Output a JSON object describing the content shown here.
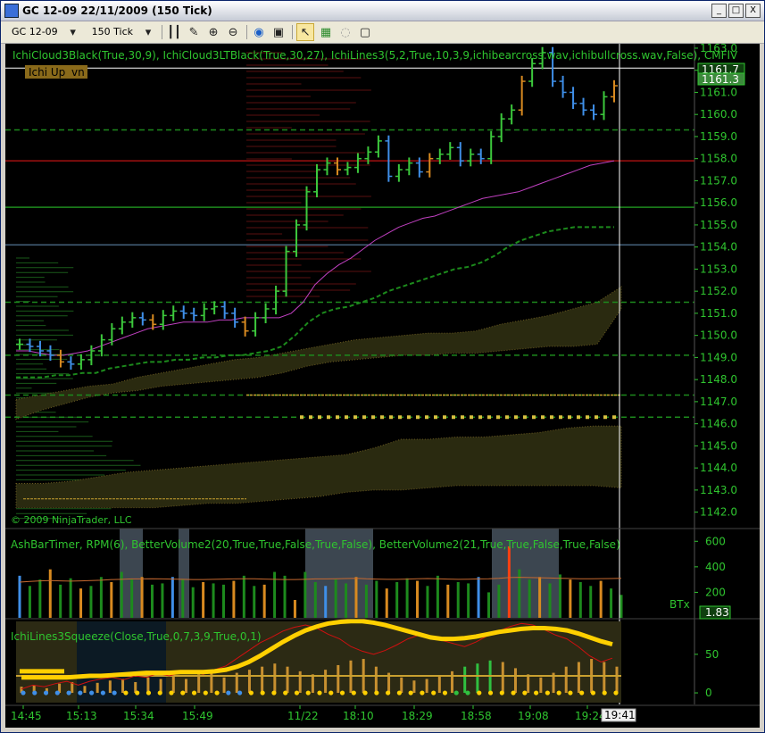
{
  "window": {
    "title": "GC 12-09  22/11/2009 (150 Tick)",
    "buttons": [
      "_",
      "□",
      "X"
    ]
  },
  "toolbar": {
    "instrument": "GC 12-09",
    "interval": "150 Tick",
    "icons": [
      "bar-type-icon",
      "pencil-icon",
      "zoom-in-icon",
      "zoom-out-icon",
      "globe-icon",
      "properties-icon",
      "cursor-icon",
      "data-box-icon",
      "ninja-icon",
      "copy-icon"
    ]
  },
  "chart_data": [
    {
      "type": "line",
      "panel": "price",
      "indicator_label": "IchiCloud3Black(True,30,9),  IchiCloud3LTBlack(True,30,27),  IchiLines3(5,2,True,10,3,9,ichibearcross.wav,ichibullcross.wav,False),  CMFIV",
      "status_label": "Ichi Up",
      "status_label_suffix": "vn",
      "copyright": "© 2009 NinjaTrader, LLC",
      "ylim": [
        1141.5,
        1163.2
      ],
      "yticks": [
        "1163.0",
        "1162.0",
        "1161.0",
        "1160.0",
        "1159.0",
        "1158.0",
        "1157.0",
        "1156.0",
        "1155.0",
        "1154.0",
        "1153.0",
        "1152.0",
        "1151.0",
        "1150.0",
        "1149.0",
        "1148.0",
        "1147.0",
        "1146.0",
        "1145.0",
        "1144.0",
        "1143.0",
        "1142.0"
      ],
      "last_price_labels": [
        "1161.7",
        "1161.3"
      ],
      "close": [
        1149.6,
        1149.5,
        1149.3,
        1149.1,
        1148.8,
        1148.7,
        1148.9,
        1149.3,
        1149.8,
        1150.3,
        1150.6,
        1150.8,
        1150.7,
        1150.5,
        1150.9,
        1151.1,
        1151.0,
        1150.9,
        1151.2,
        1151.3,
        1151.0,
        1150.6,
        1150.2,
        1150.8,
        1151.2,
        1152.0,
        1153.8,
        1155.0,
        1156.5,
        1157.5,
        1157.8,
        1157.5,
        1157.6,
        1158.0,
        1158.3,
        1158.8,
        1157.2,
        1157.5,
        1157.8,
        1157.4,
        1158.0,
        1158.2,
        1158.5,
        1157.9,
        1158.2,
        1158.0,
        1159.0,
        1159.8,
        1160.2,
        1161.5,
        1162.3,
        1162.8,
        1161.5,
        1161.0,
        1160.5,
        1160.2,
        1160.0,
        1160.8,
        1161.3
      ],
      "high_low_range": [
        1.0,
        1.4
      ],
      "tenkan": [
        1149.3,
        1149.3,
        1149.2,
        1149.1,
        1149.1,
        1149.2,
        1149.3,
        1149.5,
        1149.7,
        1149.9,
        1150.1,
        1150.3,
        1150.4,
        1150.5,
        1150.6,
        1150.6,
        1150.6,
        1150.7,
        1150.7,
        1150.8,
        1150.8,
        1150.8,
        1150.8,
        1151.0,
        1151.5,
        1152.3,
        1152.8,
        1153.2,
        1153.5,
        1153.9,
        1154.3,
        1154.6,
        1154.9,
        1155.1,
        1155.3,
        1155.4,
        1155.6,
        1155.8,
        1156.0,
        1156.2,
        1156.3,
        1156.4,
        1156.5,
        1156.7,
        1156.9,
        1157.1,
        1157.3,
        1157.5,
        1157.7,
        1157.8,
        1157.9
      ],
      "kijun": [
        1148.1,
        1148.1,
        1148.1,
        1148.2,
        1148.2,
        1148.3,
        1148.3,
        1148.5,
        1148.6,
        1148.7,
        1148.8,
        1148.8,
        1148.9,
        1148.9,
        1149.0,
        1149.0,
        1149.1,
        1149.1,
        1149.2,
        1149.3,
        1149.5,
        1150.0,
        1150.6,
        1151.0,
        1151.2,
        1151.3,
        1151.5,
        1151.7,
        1152.0,
        1152.2,
        1152.4,
        1152.6,
        1152.8,
        1153.0,
        1153.1,
        1153.3,
        1153.6,
        1154.0,
        1154.3,
        1154.5,
        1154.7,
        1154.8,
        1154.9,
        1154.9,
        1154.9,
        1154.9
      ],
      "cloud_top": [
        1147.1,
        1147.3,
        1147.5,
        1147.7,
        1147.8,
        1148.1,
        1148.3,
        1148.5,
        1148.7,
        1148.9,
        1149.0,
        1149.2,
        1149.4,
        1149.6,
        1149.8,
        1149.9,
        1150.0,
        1150.1,
        1150.1,
        1150.2,
        1150.5,
        1150.7,
        1150.9,
        1151.2,
        1151.5,
        1152.2
      ],
      "cloud_bottom": [
        1146.2,
        1146.6,
        1146.9,
        1147.2,
        1147.4,
        1147.5,
        1147.7,
        1147.8,
        1147.9,
        1148.0,
        1148.1,
        1148.3,
        1148.6,
        1148.8,
        1148.9,
        1149.0,
        1149.1,
        1149.1,
        1149.2,
        1149.2,
        1149.3,
        1149.4,
        1149.5,
        1149.5,
        1149.6,
        1151.2
      ],
      "lt_cloud_top": [
        1143.3,
        1143.3,
        1143.4,
        1143.6,
        1143.8,
        1143.9,
        1144.0,
        1144.1,
        1144.2,
        1144.3,
        1144.4,
        1144.5,
        1144.6,
        1144.9,
        1145.3,
        1145.3,
        1145.4,
        1145.4,
        1145.5,
        1145.6,
        1145.8,
        1145.9,
        1145.9
      ],
      "lt_cloud_bottom": [
        1142.2,
        1142.2,
        1142.2,
        1142.2,
        1142.2,
        1142.2,
        1142.3,
        1142.4,
        1142.4,
        1142.5,
        1142.6,
        1142.7,
        1142.9,
        1143.0,
        1143.0,
        1143.1,
        1143.2,
        1143.2,
        1143.2,
        1143.2,
        1143.2,
        1143.2,
        1143.1
      ],
      "hlines": [
        1162.1,
        1159.3,
        1157.9,
        1155.8,
        1154.1,
        1151.5,
        1149.1,
        1147.3,
        1146.3
      ]
    },
    {
      "type": "bar",
      "panel": "volume",
      "indicator_label": "AshBarTimer,  RPM(6),  BetterVolume2(20,True,True,False,True,False),  BetterVolume2(21,True,True,False,True,False)",
      "ylim": [
        0,
        700
      ],
      "yticks": [
        "600",
        "400",
        "200"
      ],
      "right_label": "BTx",
      "value_label": "1.83",
      "values": [
        330,
        250,
        300,
        380,
        260,
        310,
        230,
        250,
        320,
        280,
        360,
        300,
        320,
        260,
        270,
        320,
        300,
        240,
        280,
        270,
        260,
        290,
        330,
        250,
        260,
        360,
        330,
        140,
        360,
        280,
        250,
        300,
        270,
        320,
        260,
        290,
        230,
        280,
        310,
        290,
        250,
        330,
        260,
        280,
        270,
        320,
        200,
        260,
        560,
        380,
        300,
        320,
        270,
        340,
        300,
        280,
        250,
        290,
        230,
        180
      ],
      "ma": [
        280,
        285,
        290,
        292,
        290,
        288,
        290,
        292,
        295,
        300,
        302,
        305,
        305,
        306,
        305,
        304,
        302,
        300,
        300,
        302,
        304,
        305,
        306,
        306,
        304,
        302,
        300,
        300,
        302,
        305,
        305,
        306,
        308,
        310,
        306,
        304,
        302,
        302,
        304,
        306,
        308,
        306,
        304,
        302,
        303,
        305,
        306,
        310,
        316,
        318,
        316,
        314,
        312,
        310,
        308,
        306,
        306,
        307,
        308,
        310
      ]
    },
    {
      "type": "area",
      "panel": "squeeze",
      "indicator_label": "IchiLines3Squeeze(Close,True,0,7,3,9,True,0,1)",
      "ylim": [
        -15,
        95
      ],
      "yticks": [
        "50",
        "0"
      ],
      "momentum_line": [
        20,
        20,
        20,
        20,
        20,
        21,
        22,
        22,
        23,
        24,
        25,
        26,
        26,
        26,
        27,
        27,
        27,
        28,
        30,
        34,
        40,
        48,
        57,
        66,
        74,
        81,
        86,
        90,
        92,
        93,
        93,
        91,
        88,
        84,
        80,
        76,
        72,
        70,
        70,
        71,
        73,
        76,
        79,
        81,
        83,
        84,
        84,
        83,
        81,
        77,
        72,
        67,
        63
      ],
      "signal_line": [
        5,
        10,
        8,
        12,
        15,
        10,
        15,
        18,
        20,
        17,
        22,
        20,
        25,
        22,
        26,
        28,
        24,
        30,
        35,
        45,
        55,
        65,
        72,
        80,
        85,
        88,
        84,
        76,
        70,
        60,
        54,
        50,
        55,
        62,
        70,
        75,
        72,
        68,
        64,
        60,
        66,
        74,
        80,
        86,
        90,
        88,
        82,
        75,
        70,
        60,
        48,
        40,
        45
      ],
      "histogram": [
        8,
        10,
        6,
        12,
        14,
        9,
        13,
        16,
        18,
        14,
        20,
        18,
        22,
        18,
        24,
        26,
        20,
        26,
        30,
        34,
        38,
        34,
        28,
        24,
        30,
        36,
        42,
        44,
        34,
        26,
        20,
        16,
        18,
        22,
        28,
        34,
        38,
        42,
        40,
        32,
        24,
        20,
        26,
        34,
        40,
        44,
        40,
        34
      ],
      "squeeze_dots": [
        "blue",
        "blue",
        "blue",
        "blue",
        "blue",
        "blue",
        "blue",
        "blue",
        "blue",
        "yellow",
        "yellow",
        "yellow",
        "yellow",
        "yellow",
        "yellow",
        "yellow",
        "yellow",
        "yellow",
        "blue",
        "blue",
        "yellow",
        "yellow",
        "yellow",
        "yellow",
        "yellow",
        "yellow",
        "yellow",
        "yellow",
        "yellow",
        "yellow",
        "yellow",
        "yellow",
        "yellow",
        "yellow",
        "yellow",
        "yellow",
        "yellow",
        "yellow",
        "green",
        "green",
        "yellow",
        "yellow",
        "yellow",
        "yellow",
        "yellow",
        "yellow",
        "yellow",
        "yellow",
        "yellow",
        "yellow",
        "yellow",
        "yellow",
        "yellow"
      ]
    }
  ],
  "time_axis": {
    "labels": [
      "14:45",
      "15:13",
      "15:34",
      "15:49",
      "11/22",
      "18:10",
      "18:29",
      "18:58",
      "19:08",
      "19:24"
    ],
    "current_time": "19:41"
  },
  "colors": {
    "background": "#000000",
    "axis_text": "#2fc52f",
    "label_text": "#2fc52f",
    "tenkan": "#c040c0",
    "kijun": "#1c8a1c",
    "cloud_fill": "#2a2a10",
    "squeeze_fill": "#2c2a14",
    "momentum": "#ffd000",
    "signal": "#d01010",
    "cursor": "#ffffff"
  }
}
